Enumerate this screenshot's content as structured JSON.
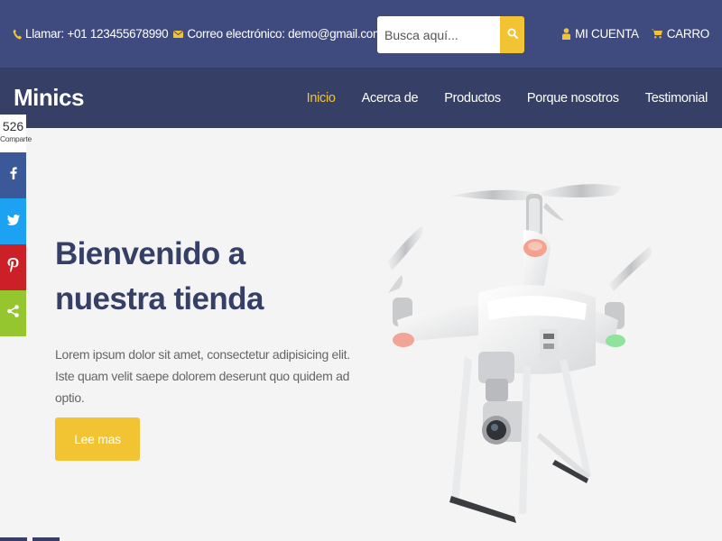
{
  "topbar": {
    "phone": "Llamar: +01 123455678990",
    "email": "Correo electrónico: demo@gmail.com",
    "search_placeholder": "Busca aquí...",
    "account": "MI CUENTA",
    "cart": "CARRO"
  },
  "nav": {
    "logo": "Minics",
    "items": [
      {
        "label": "Inicio",
        "active": true
      },
      {
        "label": "Acerca de"
      },
      {
        "label": "Productos"
      },
      {
        "label": "Porque nosotros"
      },
      {
        "label": "Testimonial"
      }
    ]
  },
  "share": {
    "count": "526",
    "label": "Comparte"
  },
  "hero": {
    "title": "Bienvenido a nuestra tienda",
    "text": "Lorem ipsum dolor sit amet, consectetur adipisicing elit. Iste quam velit saepe dolorem deserunt quo quidem ad optio.",
    "button": "Lee mas"
  },
  "colors": {
    "topbar": "#3f4b7e",
    "navbar": "#364066",
    "accent": "#f2c434",
    "facebook": "#3b5998",
    "twitter": "#1da1f2",
    "pinterest": "#cb2027",
    "share": "#95c630"
  }
}
